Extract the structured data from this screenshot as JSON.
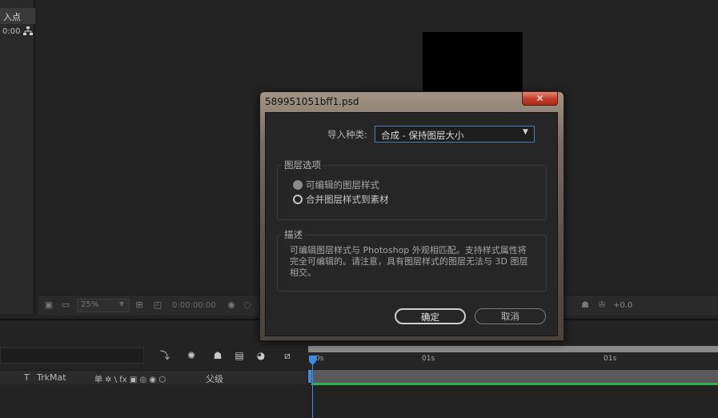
{
  "project_panel": {
    "header_label": "入点",
    "time_value": "0:00",
    "hierarchy_icon": "hierarchy-icon"
  },
  "viewer": {
    "zoom_value": "25%",
    "time_readout": "0:00:00:00",
    "offset_readout": "+0.0"
  },
  "timeline": {
    "columns": {
      "t_label": "T",
      "trkmat_label": "TrkMat",
      "switches_label": "单 ✲ \\ fx ▣ ◎ ◉ ⬡",
      "parent_label": "父级"
    },
    "ruler_ticks": [
      "0s",
      "01s",
      "01s"
    ],
    "layer_bar_color": "#5a5a5a",
    "track_color": "#2fb34a"
  },
  "dialog": {
    "title": "589951051bff1.psd",
    "close_glyph": "✕",
    "import_kind_label": "导入种类:",
    "import_kind_value": "合成 - 保持图层大小",
    "layer_options_title": "图层选项",
    "options": [
      {
        "label": "可编辑的图层样式",
        "selected": true,
        "disabled": true
      },
      {
        "label": "合并图层样式到素材",
        "selected": false,
        "disabled": false
      }
    ],
    "description_title": "描述",
    "description_text": "可编辑图层样式与 Photoshop 外观相匹配。支持样式属性将完全可编辑的。请注意，具有图层样式的图层无法与 3D 图层相交。",
    "ok_label": "确定",
    "cancel_label": "取消"
  },
  "colors": {
    "accent_blue": "#3a8ee8",
    "track_green": "#2fb34a",
    "close_red": "#c6402c"
  }
}
